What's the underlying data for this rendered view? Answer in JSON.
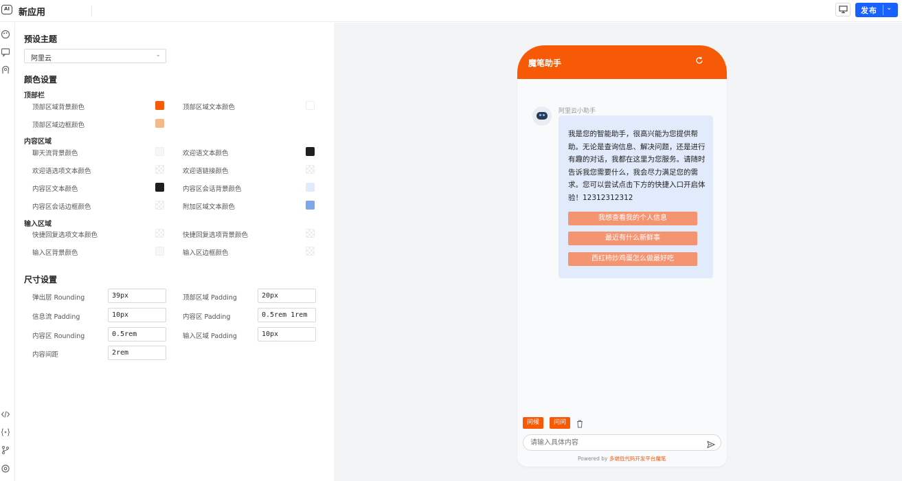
{
  "header": {
    "app_title": "新应用",
    "publish_label": "发布",
    "logo_text": "AI"
  },
  "settings": {
    "theme": {
      "title": "预设主题",
      "selected": "阿里云"
    },
    "colors": {
      "title": "颜色设置",
      "groups": [
        {
          "title": "顶部栏",
          "items": [
            {
              "label": "顶部区域背景颜色",
              "color": "#f65a06"
            },
            {
              "label": "顶部区域文本颜色",
              "color": "#ffffff"
            },
            {
              "label": "顶部区域边框颜色",
              "color": "#f5b98a"
            }
          ]
        },
        {
          "title": "内容区域",
          "items": [
            {
              "label": "聊天流背景颜色",
              "color": "#f6f7f8"
            },
            {
              "label": "欢迎语文本颜色",
              "color": "#1f1f1f"
            },
            {
              "label": "欢迎语选项文本颜色",
              "color": "transparent"
            },
            {
              "label": "欢迎语链接颜色",
              "color": "transparent"
            },
            {
              "label": "内容区文本颜色",
              "color": "#1f1f1f"
            },
            {
              "label": "内容区会话背景颜色",
              "color": "#e1ebfb"
            },
            {
              "label": "内容区会话边框颜色",
              "color": "transparent"
            },
            {
              "label": "附加区域文本颜色",
              "color": "#7fa6e6"
            }
          ]
        },
        {
          "title": "输入区域",
          "items": [
            {
              "label": "快捷回复选项文本颜色",
              "color": "transparent"
            },
            {
              "label": "快捷回复选项背景颜色",
              "color": "transparent"
            },
            {
              "label": "输入区背景颜色",
              "color": "#f6f7f8"
            },
            {
              "label": "输入区边框颜色",
              "color": "transparent"
            }
          ]
        }
      ]
    },
    "sizes": {
      "title": "尺寸设置",
      "items": [
        {
          "label": "弹出层 Rounding",
          "value": "39px"
        },
        {
          "label": "顶部区域 Padding",
          "value": "20px"
        },
        {
          "label": "信息流 Padding",
          "value": "10px"
        },
        {
          "label": "内容区 Padding",
          "value": "0.5rem 1rem"
        },
        {
          "label": "内容区 Rounding",
          "value": "0.5rem"
        },
        {
          "label": "输入区域 Padding",
          "value": "10px"
        },
        {
          "label": "内容间距",
          "value": "2rem"
        }
      ]
    }
  },
  "preview": {
    "title": "魔笔助手",
    "bot_name": "阿里云小助手",
    "welcome_text": "我是您的智能助手，很高兴能为您提供帮助。无论是查询信息、解决问题，还是进行有趣的对话，我都在这里为您服务。请随时告诉我您需要什么，我会尽力满足您的需求。您可以尝试点击下方的快捷入口开启体验！12312312312",
    "quick_replies": [
      "我想查看我的个人信息",
      "最近有什么新鲜事",
      "西红柿炒鸡蛋怎么做最好吃"
    ],
    "tags": [
      "问候",
      "问问"
    ],
    "input_placeholder": "请输入具体内容",
    "powered_by_prefix": "Powered by ",
    "powered_by_brand": "多端低代码开发平台魔笔"
  }
}
